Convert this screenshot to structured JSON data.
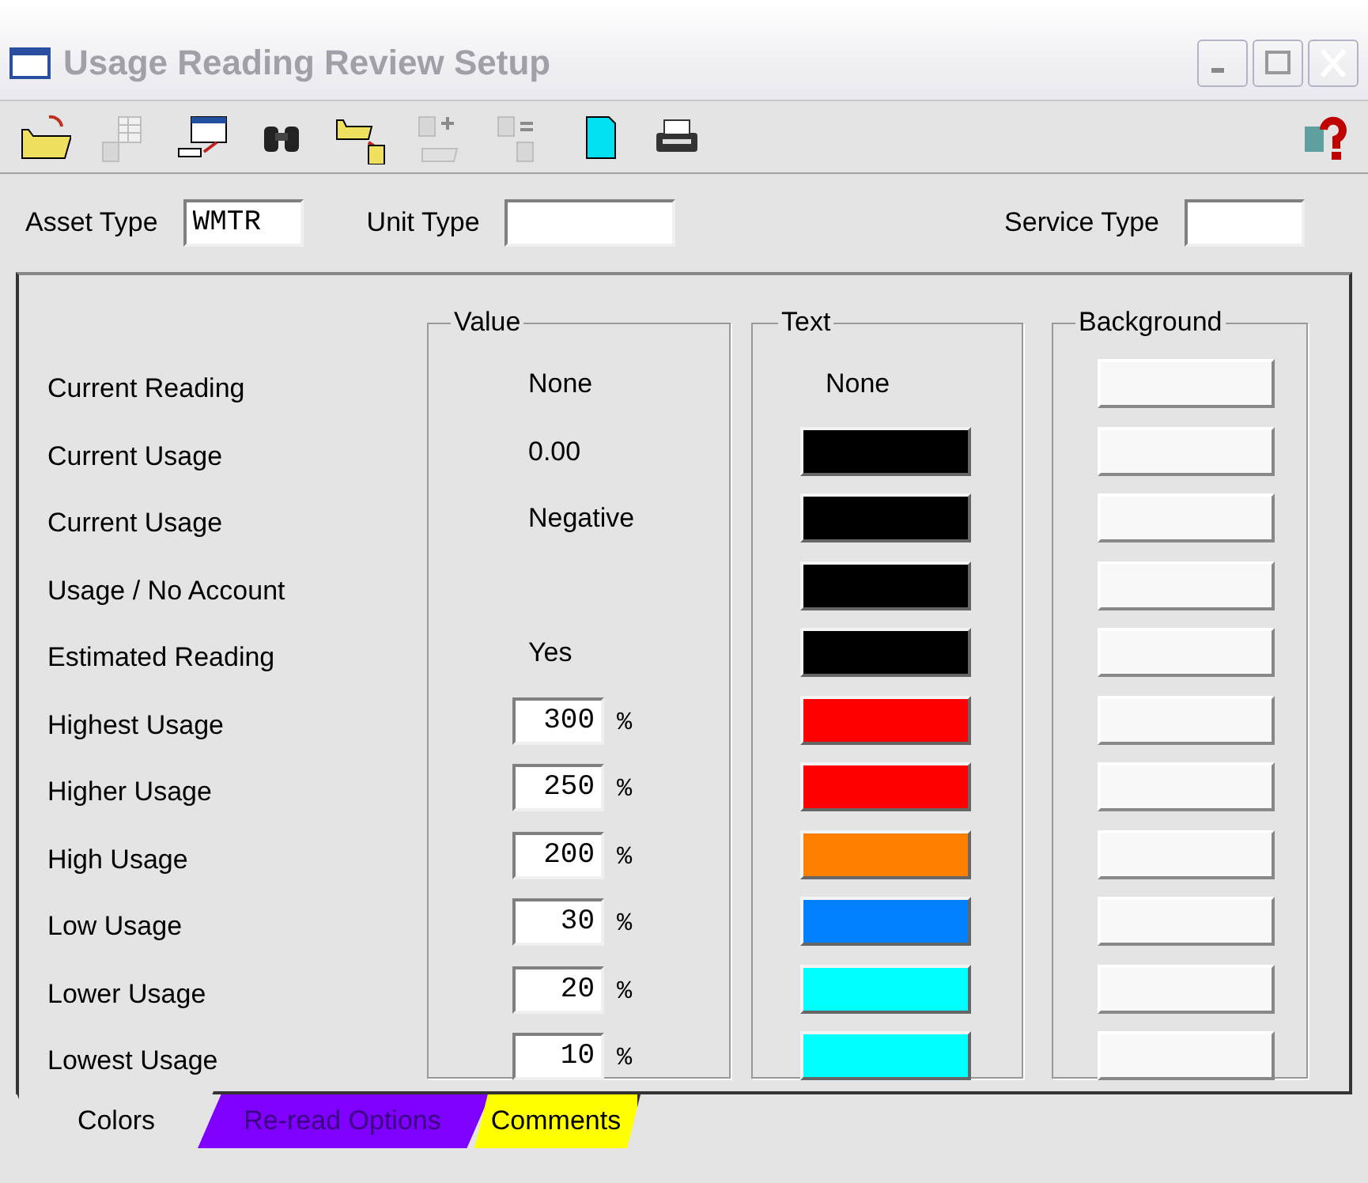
{
  "window": {
    "title": "Usage Reading Review Setup"
  },
  "toolbar": {
    "buttons": [
      {
        "kind": "open",
        "disabled": false
      },
      {
        "kind": "columns",
        "disabled": true
      },
      {
        "kind": "export",
        "disabled": false
      },
      {
        "kind": "find",
        "disabled": false
      },
      {
        "kind": "move",
        "disabled": false
      },
      {
        "kind": "add",
        "disabled": true
      },
      {
        "kind": "remove",
        "disabled": true
      },
      {
        "kind": "new",
        "disabled": false
      },
      {
        "kind": "print",
        "disabled": false
      }
    ]
  },
  "header": [
    {
      "label": "Asset Type",
      "value": "WMTR"
    },
    {
      "label": "Unit Type"
    },
    {
      "label": "Service Type"
    }
  ],
  "groups": [
    "Value",
    "Text",
    "Background"
  ],
  "rows": [
    {
      "label": "Current Reading",
      "value": {
        "kind": "text",
        "text": "None"
      },
      "text": {
        "kind": "none",
        "text": "None"
      }
    },
    {
      "label": "Current Usage",
      "value": {
        "kind": "text",
        "text": "0.00"
      },
      "text": {
        "kind": "swatch",
        "color": "#000000"
      }
    },
    {
      "label": "Current Usage",
      "value": {
        "kind": "text",
        "text": "Negative"
      },
      "text": {
        "kind": "swatch",
        "color": "#000000"
      }
    },
    {
      "label": "Usage / No Account",
      "text": {
        "kind": "swatch",
        "color": "#000000"
      }
    },
    {
      "label": "Estimated Reading",
      "value": {
        "kind": "text",
        "text": "Yes"
      },
      "text": {
        "kind": "swatch",
        "color": "#000000"
      }
    },
    {
      "label": "Highest Usage",
      "value": {
        "kind": "percent",
        "text": "300",
        "unit": "%"
      },
      "text": {
        "kind": "swatch",
        "color": "#ff0000"
      }
    },
    {
      "label": "Higher Usage",
      "value": {
        "kind": "percent",
        "text": "250",
        "unit": "%"
      },
      "text": {
        "kind": "swatch",
        "color": "#ff0000"
      }
    },
    {
      "label": "High Usage",
      "value": {
        "kind": "percent",
        "text": "200",
        "unit": "%"
      },
      "text": {
        "kind": "swatch",
        "color": "#ff8000"
      }
    },
    {
      "label": "Low Usage",
      "value": {
        "kind": "percent",
        "text": "30",
        "unit": "%"
      },
      "text": {
        "kind": "swatch",
        "color": "#0080ff"
      }
    },
    {
      "label": "Lower Usage",
      "value": {
        "kind": "percent",
        "text": "20",
        "unit": "%"
      },
      "text": {
        "kind": "swatch",
        "color": "#00ffff"
      }
    },
    {
      "label": "Lowest Usage",
      "value": {
        "kind": "percent",
        "text": "10",
        "unit": "%"
      },
      "text": {
        "kind": "swatch",
        "color": "#00ffff"
      }
    }
  ],
  "tabs": [
    {
      "label": "Colors",
      "selected": true,
      "color": "#e4e4e4"
    },
    {
      "label": "Re-read Options",
      "selected": false,
      "color": "#7f00ff"
    },
    {
      "label": "Comments",
      "selected": false,
      "color": "#ffff00"
    }
  ]
}
